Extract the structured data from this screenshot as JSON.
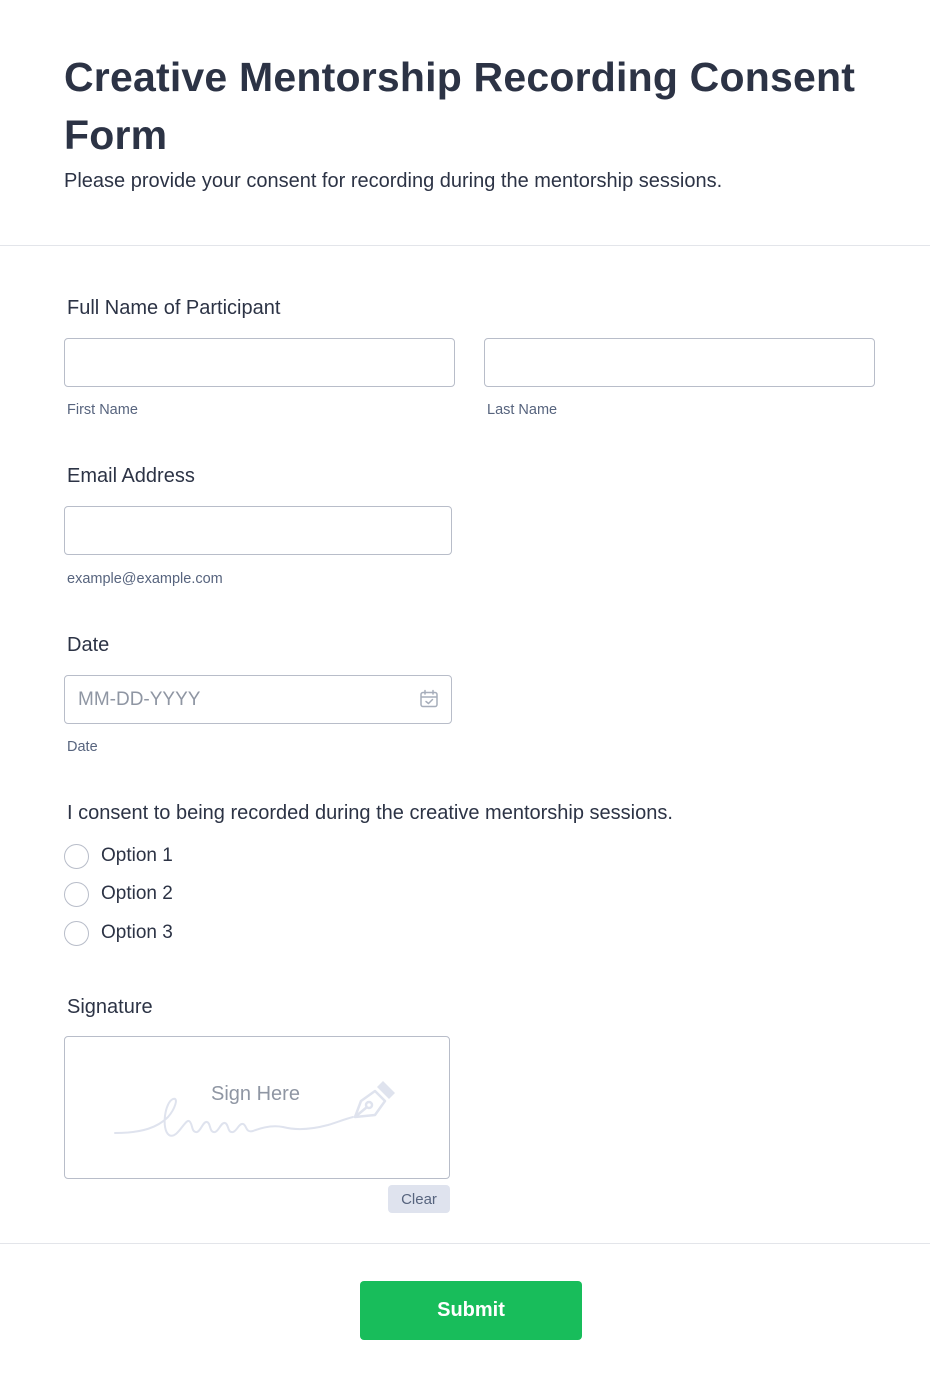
{
  "form": {
    "title": "Creative Mentorship Recording Consent Form",
    "subtitle": "Please provide your consent for recording during the mentorship sessions."
  },
  "full_name": {
    "label": "Full Name of Participant",
    "first_value": "",
    "first_sublabel": "First Name",
    "last_value": "",
    "last_sublabel": "Last Name"
  },
  "email": {
    "label": "Email Address",
    "value": "",
    "sublabel": "example@example.com"
  },
  "date": {
    "label": "Date",
    "placeholder": "MM-DD-YYYY",
    "sublabel": "Date",
    "icon": "calendar-icon"
  },
  "consent": {
    "question": "I consent to being recorded during the creative mentorship sessions.",
    "options": [
      "Option 1",
      "Option 2",
      "Option 3"
    ]
  },
  "signature": {
    "label": "Signature",
    "hint": "Sign Here",
    "clear_label": "Clear",
    "icon": "pen-nib-icon"
  },
  "submit": {
    "label": "Submit"
  },
  "colors": {
    "text": "#2c3345",
    "border": "#b8bdc9",
    "submit": "#18bd5b",
    "clear_bg": "#dfe3ee"
  }
}
